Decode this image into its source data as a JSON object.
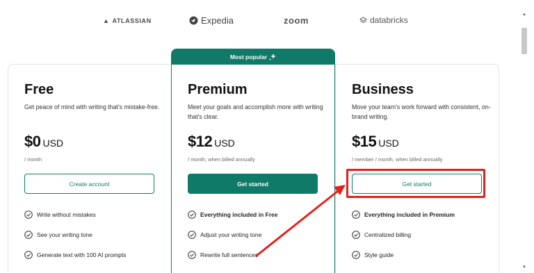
{
  "logos": [
    {
      "name": "atlassian",
      "text": "ATLASSIAN"
    },
    {
      "name": "expedia",
      "text": "Expedia"
    },
    {
      "name": "zoom",
      "text": "zoom"
    },
    {
      "name": "databricks",
      "text": "databricks"
    }
  ],
  "badge": {
    "text": "Most popular"
  },
  "plans": {
    "free": {
      "name": "Free",
      "description": "Get peace of mind with writing that's mistake-free.",
      "price": "$0",
      "currency": "USD",
      "billing": "/ month",
      "cta": "Create account",
      "features": [
        "Write without mistakes",
        "See your writing tone",
        "Generate text with 100 AI prompts"
      ]
    },
    "premium": {
      "name": "Premium",
      "description": "Meet your goals and accomplish more with writing that's clear.",
      "price": "$12",
      "currency": "USD",
      "billing": "/ month, when billed annually",
      "cta": "Get started",
      "features": [
        "Everything included in Free",
        "Adjust your writing tone",
        "Rewrite full sentences"
      ]
    },
    "business": {
      "name": "Business",
      "description": "Move your team's work forward with consistent, on-brand writing.",
      "price": "$15",
      "currency": "USD",
      "billing": "/ member / month, when billed annually",
      "cta": "Get started",
      "features": [
        "Everything included in Premium",
        "Centralized billing",
        "Style guide"
      ]
    }
  },
  "colors": {
    "brand": "#0e7a67",
    "annotation": "#e2211c"
  }
}
